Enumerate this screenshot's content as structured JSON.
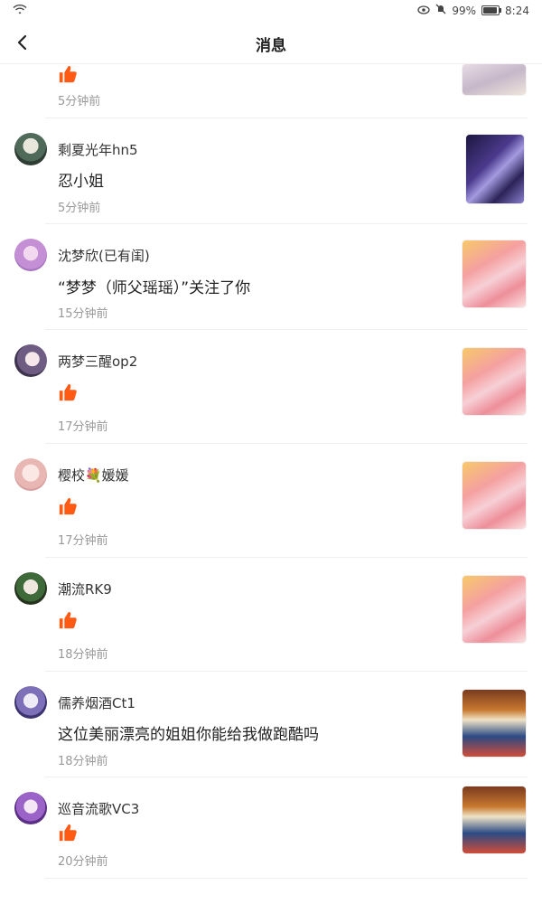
{
  "status_bar": {
    "battery": "99%",
    "time": "8:24"
  },
  "header": {
    "title": "消息"
  },
  "first_row": {
    "time": "5分钟前"
  },
  "rows": [
    {
      "name": "剩夏光年hn5",
      "message": "忍小姐",
      "time": "5分钟前"
    },
    {
      "name": "沈梦欣(已有闺)",
      "message": "“梦梦（师父瑶瑶）”关注了你",
      "time": "15分钟前"
    },
    {
      "name": "两梦三醒op2",
      "time": "17分钟前"
    },
    {
      "name": "樱校💐媛媛",
      "time": "17分钟前"
    },
    {
      "name": "潮流RK9",
      "time": "18分钟前"
    },
    {
      "name": "儒养烟酒Ct1",
      "message": "这位美丽漂亮的姐姐你能给我做跑酷吗",
      "time": "18分钟前"
    },
    {
      "name": "巡音流歌VC3",
      "time": "20分钟前"
    }
  ],
  "colors": {
    "accent": "#ff5a14",
    "divider": "#efefef",
    "time": "#999999"
  }
}
